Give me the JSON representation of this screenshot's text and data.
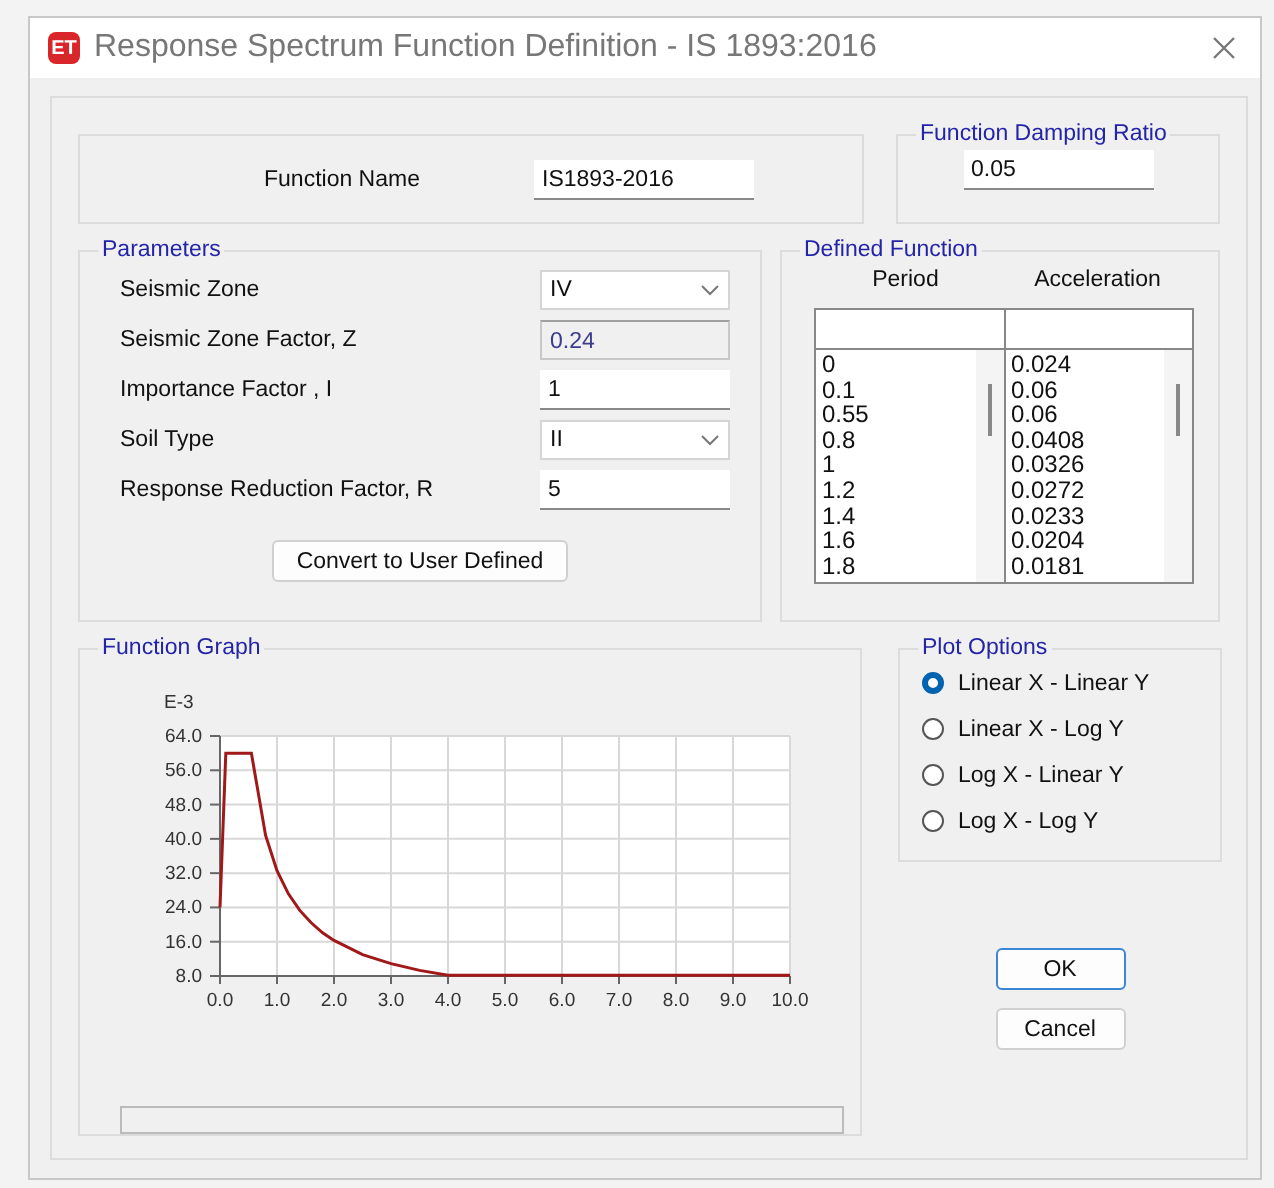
{
  "window": {
    "title": "Response Spectrum Function Definition - IS 1893:2016",
    "icon_text": "ET"
  },
  "function_name": {
    "label": "Function Name",
    "value": "IS1893-2016"
  },
  "damping": {
    "title": "Function Damping Ratio",
    "value": "0.05"
  },
  "parameters": {
    "title": "Parameters",
    "fields": [
      {
        "kind": "dropdown",
        "label": "Seismic Zone",
        "value": "IV"
      },
      {
        "kind": "readonly",
        "label": "Seismic Zone Factor, Z",
        "value": "0.24"
      },
      {
        "kind": "text",
        "label": "Importance Factor , I",
        "value": "1"
      },
      {
        "kind": "dropdown",
        "label": "Soil Type",
        "value": "II"
      },
      {
        "kind": "text",
        "label": "Response Reduction Factor, R",
        "value": "5"
      }
    ],
    "convert_button": "Convert to User Defined"
  },
  "defined_function": {
    "title": "Defined Function",
    "columns": [
      "Period",
      "Acceleration"
    ],
    "rows": [
      [
        "0",
        "0.024"
      ],
      [
        "0.1",
        "0.06"
      ],
      [
        "0.55",
        "0.06"
      ],
      [
        "0.8",
        "0.0408"
      ],
      [
        "1",
        "0.0326"
      ],
      [
        "1.2",
        "0.0272"
      ],
      [
        "1.4",
        "0.0233"
      ],
      [
        "1.6",
        "0.0204"
      ],
      [
        "1.8",
        "0.0181"
      ]
    ]
  },
  "function_graph": {
    "title": "Function Graph",
    "chart_data": {
      "type": "line",
      "ylabel": "E-3",
      "x": [
        0,
        0.1,
        0.55,
        0.8,
        1,
        1.2,
        1.4,
        1.6,
        1.8,
        2,
        2.5,
        3,
        3.5,
        4,
        10
      ],
      "series": [
        {
          "color": "#a01818",
          "values": [
            24,
            60,
            60,
            40.8,
            32.6,
            27.2,
            23.3,
            20.4,
            18.1,
            16.3,
            13.0,
            10.9,
            9.3,
            8.2,
            8.2
          ]
        }
      ],
      "xlim": [
        0,
        10
      ],
      "ylim": [
        8,
        64
      ],
      "grid": true,
      "xticks": [
        {
          "value": 0,
          "label": "0.0"
        },
        {
          "value": 1,
          "label": "1.0"
        },
        {
          "value": 2,
          "label": "2.0"
        },
        {
          "value": 3,
          "label": "3.0"
        },
        {
          "value": 4,
          "label": "4.0"
        },
        {
          "value": 5,
          "label": "5.0"
        },
        {
          "value": 6,
          "label": "6.0"
        },
        {
          "value": 7,
          "label": "7.0"
        },
        {
          "value": 8,
          "label": "8.0"
        },
        {
          "value": 9,
          "label": "9.0"
        },
        {
          "value": 10,
          "label": "10.0"
        }
      ],
      "yticks": [
        {
          "value": 8,
          "label": "8.0"
        },
        {
          "value": 16,
          "label": "16.0"
        },
        {
          "value": 24,
          "label": "24.0"
        },
        {
          "value": 32,
          "label": "32.0"
        },
        {
          "value": 40,
          "label": "40.0"
        },
        {
          "value": 48,
          "label": "48.0"
        },
        {
          "value": 56,
          "label": "56.0"
        },
        {
          "value": 64,
          "label": "64.0"
        }
      ]
    }
  },
  "plot_options": {
    "title": "Plot Options",
    "options": [
      {
        "label": "Linear X - Linear Y",
        "selected": true
      },
      {
        "label": "Linear X - Log Y",
        "selected": false
      },
      {
        "label": "Log X - Linear Y",
        "selected": false
      },
      {
        "label": "Log X - Log Y",
        "selected": false
      }
    ]
  },
  "buttons": [
    {
      "label": "OK",
      "default": true
    },
    {
      "label": "Cancel",
      "default": false
    }
  ]
}
